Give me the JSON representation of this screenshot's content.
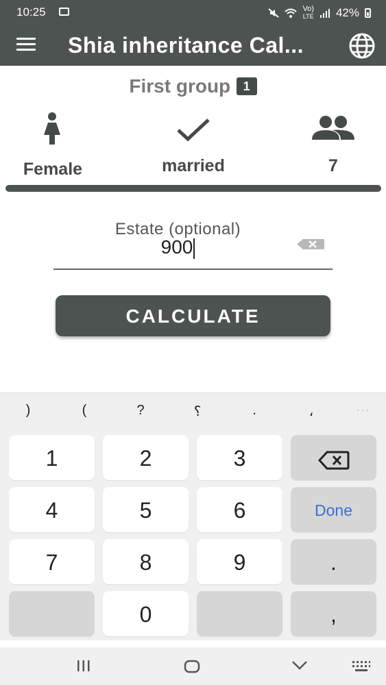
{
  "status_bar": {
    "time": "10:25",
    "volte": "Vo)",
    "lte": "LTE",
    "battery": "42%"
  },
  "app_bar": {
    "title": "Shia inheritance Cal..."
  },
  "group": {
    "title": "First group",
    "badge": "1"
  },
  "chips": [
    {
      "icon": "female-icon",
      "label": "Female"
    },
    {
      "icon": "check-icon",
      "label": "married"
    },
    {
      "icon": "people-icon",
      "label": "7"
    }
  ],
  "estate": {
    "label": "Estate (optional)",
    "value": "900"
  },
  "calculate_label": "CALCULATE",
  "keyboard": {
    "symbols": [
      ")",
      "(",
      "?",
      "؟",
      ".",
      "،",
      "···"
    ],
    "keys": {
      "k1": "1",
      "k2": "2",
      "k3": "3",
      "k4": "4",
      "k5": "5",
      "k6": "6",
      "k7": "7",
      "k8": "8",
      "k9": "9",
      "k0": "0",
      "dot": ".",
      "comma": ",",
      "done": "Done"
    }
  },
  "colors": {
    "primary": "#4d5350",
    "done_text": "#3a6fd8"
  }
}
